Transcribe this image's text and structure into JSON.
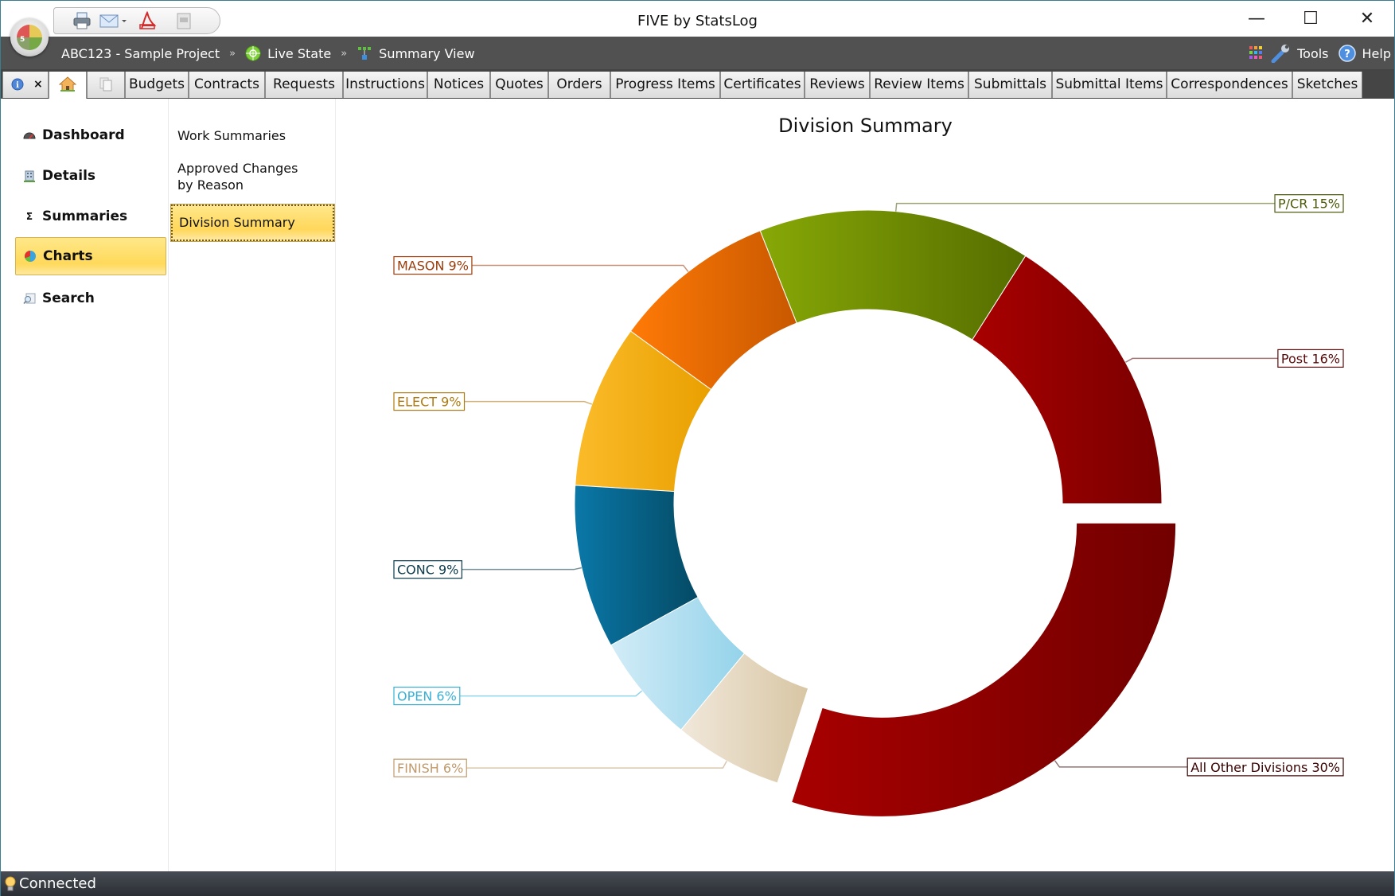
{
  "window": {
    "title": "FIVE by StatsLog",
    "minimize_glyph": "—",
    "maximize_glyph": "☐",
    "close_glyph": "✕"
  },
  "quick_access": {
    "icons": [
      "print-icon",
      "email-icon",
      "dropdown-arrow-icon",
      "pdf-icon",
      "export-icon"
    ]
  },
  "breadcrumb": {
    "project": "ABC123 - Sample Project",
    "separator": "»",
    "state": "Live State",
    "view": "Summary View"
  },
  "header_right": {
    "tools_label": "Tools",
    "help_label": "Help"
  },
  "tabs": [
    {
      "label": "Budgets"
    },
    {
      "label": "Contracts"
    },
    {
      "label": "Requests"
    },
    {
      "label": "Instructions"
    },
    {
      "label": "Notices"
    },
    {
      "label": "Quotes"
    },
    {
      "label": "Orders"
    },
    {
      "label": "Progress Items"
    },
    {
      "label": "Certificates"
    },
    {
      "label": "Reviews"
    },
    {
      "label": "Review Items"
    },
    {
      "label": "Submittals"
    },
    {
      "label": "Submittal Items"
    },
    {
      "label": "Correspondences"
    },
    {
      "label": "Sketches"
    }
  ],
  "tab_close_glyph": "×",
  "left_nav": {
    "items": [
      {
        "label": "Dashboard",
        "icon": "dashboard-gauge-icon"
      },
      {
        "label": "Details",
        "icon": "building-icon"
      },
      {
        "label": "Summaries",
        "icon": "sigma-icon"
      },
      {
        "label": "Charts",
        "icon": "pie-chart-icon",
        "selected": true
      },
      {
        "label": "Search",
        "icon": "search-icon"
      }
    ],
    "sigma_glyph": "Σ"
  },
  "sub_nav": {
    "items": [
      {
        "label": "Work Summaries"
      },
      {
        "label": "Approved Changes by Reason"
      },
      {
        "label": "Division Summary",
        "selected": true
      }
    ]
  },
  "chart_data": {
    "type": "pie",
    "variant": "donut",
    "title": "Division Summary",
    "start": "3 o'clock, counter-clockwise",
    "exploded": [
      "All Other Divisions"
    ],
    "slices": [
      {
        "name": "Post",
        "percent": 16,
        "label": "Post 16%",
        "color_light": "#a80000",
        "color_dark": "#7a0000",
        "label_color": "#5a0a0a"
      },
      {
        "name": "P/CR",
        "percent": 15,
        "label": "P/CR 15%",
        "color_light": "#87a806",
        "color_dark": "#556d00",
        "label_color": "#4a5a0a"
      },
      {
        "name": "MASON",
        "percent": 9,
        "label": "MASON 9%",
        "color_light": "#ff7a06",
        "color_dark": "#c85800",
        "label_color": "#9a3c0a"
      },
      {
        "name": "ELECT",
        "percent": 9,
        "label": "ELECT 9%",
        "color_light": "#fbbb2a",
        "color_dark": "#e9a000",
        "label_color": "#b07a10"
      },
      {
        "name": "CONC",
        "percent": 9,
        "label": "CONC 9%",
        "color_light": "#0a78a8",
        "color_dark": "#044a64",
        "label_color": "#0a3a4a"
      },
      {
        "name": "OPEN",
        "percent": 6,
        "label": "OPEN 6%",
        "color_light": "#d2ecf7",
        "color_dark": "#94d3ea",
        "label_color": "#38b0d6"
      },
      {
        "name": "FINISH",
        "percent": 6,
        "label": "FINISH 6%",
        "color_light": "#f1e8db",
        "color_dark": "#d8c6a4",
        "label_color": "#c09a6a"
      },
      {
        "name": "All Other Divisions",
        "percent": 30,
        "label": "All Other Divisions 30%",
        "color_light": "#a80000",
        "color_dark": "#720000",
        "label_color": "#3a0000"
      }
    ]
  },
  "status_bar": {
    "text": "Connected"
  }
}
